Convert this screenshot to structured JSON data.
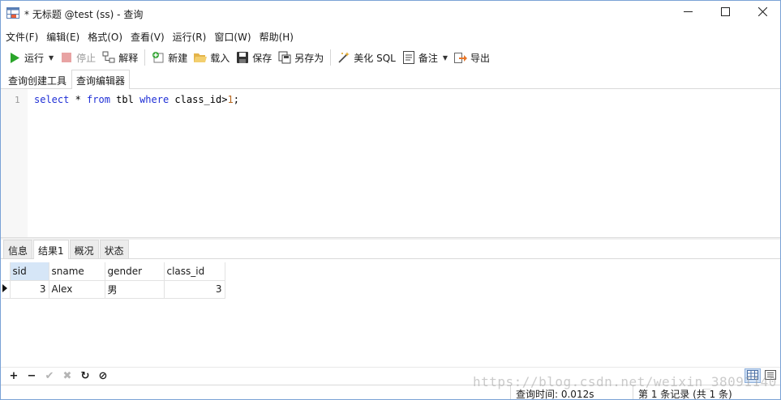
{
  "window": {
    "title": "* 无标题 @test (ss) - 查询",
    "minimize_icon": "minimize-icon",
    "maximize_icon": "maximize-icon",
    "close_icon": "close-icon"
  },
  "menu": {
    "items": [
      {
        "label": "文件(F)"
      },
      {
        "label": "编辑(E)"
      },
      {
        "label": "格式(O)"
      },
      {
        "label": "查看(V)"
      },
      {
        "label": "运行(R)"
      },
      {
        "label": "窗口(W)"
      },
      {
        "label": "帮助(H)"
      }
    ]
  },
  "toolbar": {
    "run_label": "运行",
    "stop_label": "停止",
    "explain_label": "解释",
    "new_label": "新建",
    "load_label": "载入",
    "save_label": "保存",
    "save_as_label": "另存为",
    "beautify_label": "美化 SQL",
    "memo_label": "备注",
    "export_label": "导出"
  },
  "editor_tabs": [
    {
      "label": "查询创建工具"
    },
    {
      "label": "查询编辑器"
    }
  ],
  "editor": {
    "line_number": "1",
    "tokens": {
      "t1": "select",
      "t2": " * ",
      "t3": "from",
      "t4": " tbl ",
      "t5": "where",
      "t6": " class_id>",
      "t7": "1",
      "t8": ";"
    }
  },
  "result_tabs": [
    {
      "label": "信息"
    },
    {
      "label": "结果1"
    },
    {
      "label": "概况"
    },
    {
      "label": "状态"
    }
  ],
  "grid": {
    "columns": [
      "sid",
      "sname",
      "gender",
      "class_id"
    ],
    "rows": [
      {
        "sid": "3",
        "sname": "Alex",
        "gender": "男",
        "class_id": "3"
      }
    ]
  },
  "grid_toolbar": {
    "add": "+",
    "remove": "−",
    "apply": "✔",
    "discard": "✖",
    "refresh": "↻",
    "stop": "⊘"
  },
  "status": {
    "query_time": "查询时间: 0.012s",
    "record_info": "第 1 条记录 (共 1 条)"
  },
  "watermark": "https://blog.csdn.net/weixin_38091140",
  "colors": {
    "keyword": "#1f2fd6",
    "number": "#b5651d",
    "run_green": "#2aa52a",
    "stop_red": "#e07070",
    "selected_header": "#d6e6f7"
  }
}
